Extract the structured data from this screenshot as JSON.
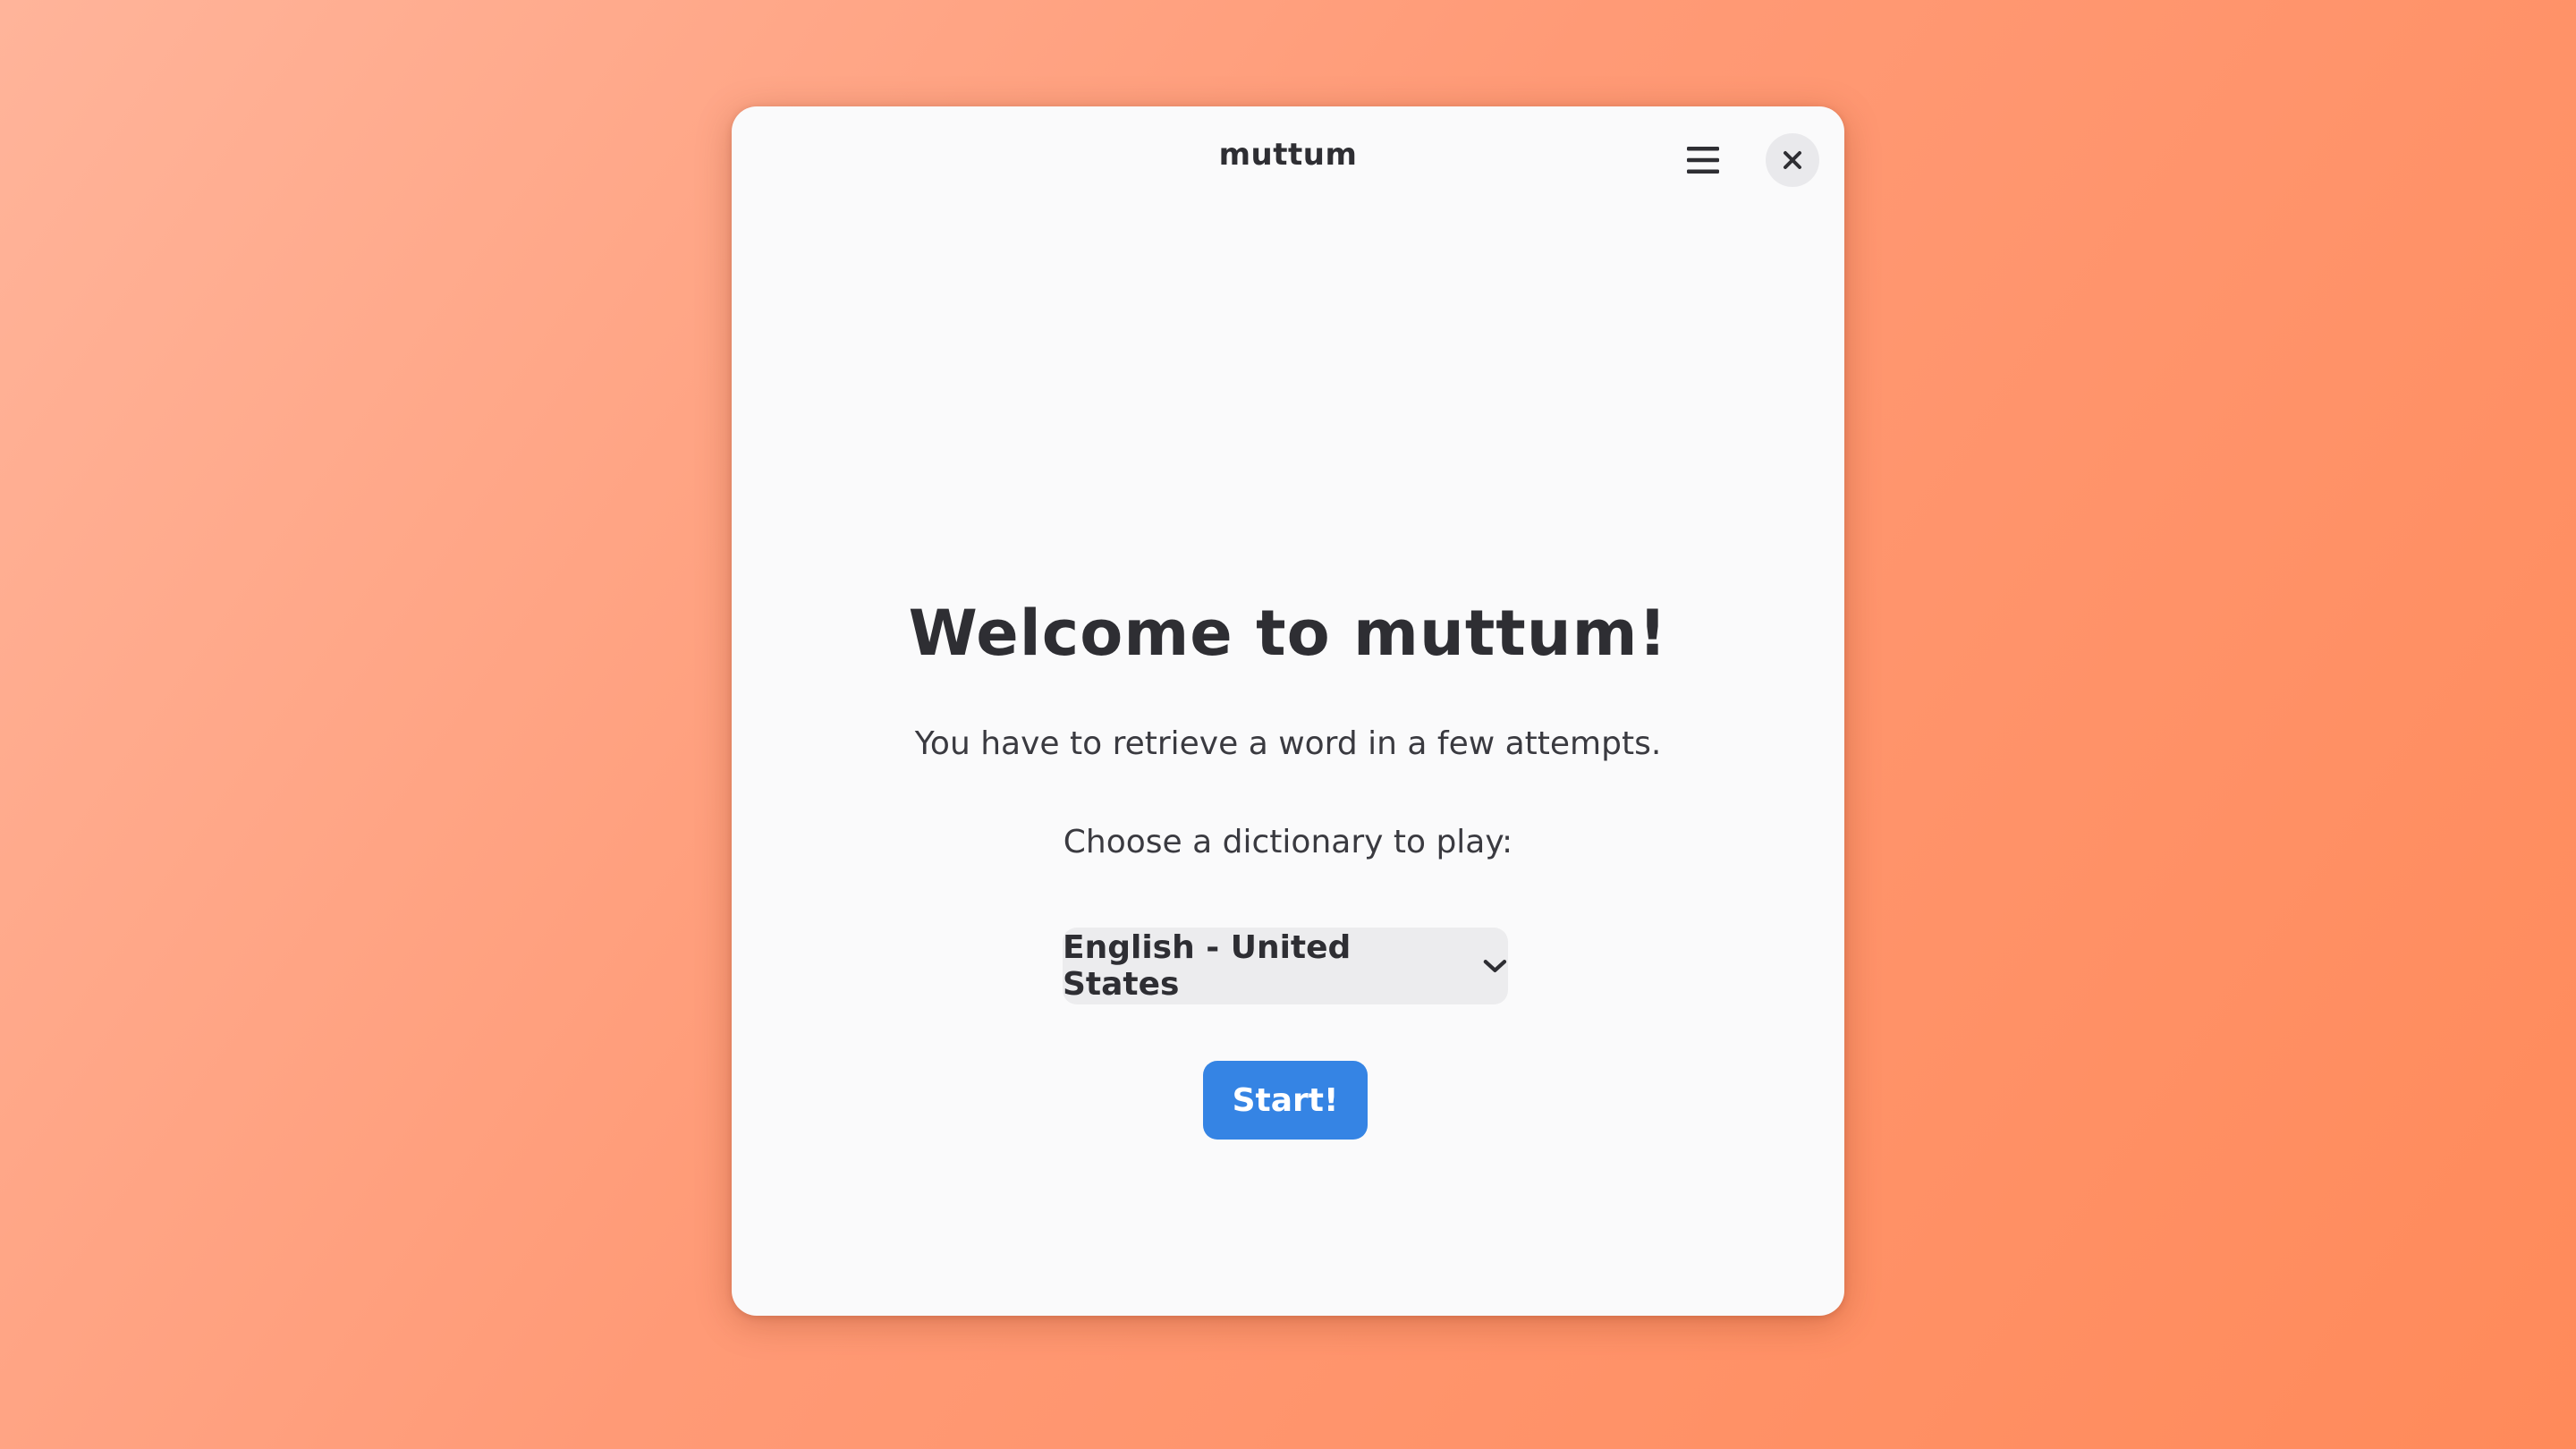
{
  "window": {
    "title": "muttum",
    "menu_icon": "hamburger-menu-icon",
    "close_icon": "close-icon"
  },
  "welcome": {
    "heading": "Welcome to muttum!",
    "description": "You have to retrieve a word in a few attempts.",
    "prompt": "Choose a dictionary to play:"
  },
  "dictionary": {
    "selected": "English - United States",
    "dropdown_icon": "chevron-down-icon"
  },
  "actions": {
    "start_label": "Start!"
  },
  "colors": {
    "accent": "#3584e4",
    "window_bg": "#fafafb",
    "background_gradient": [
      "#ffb49a",
      "#ff8a5a"
    ]
  }
}
